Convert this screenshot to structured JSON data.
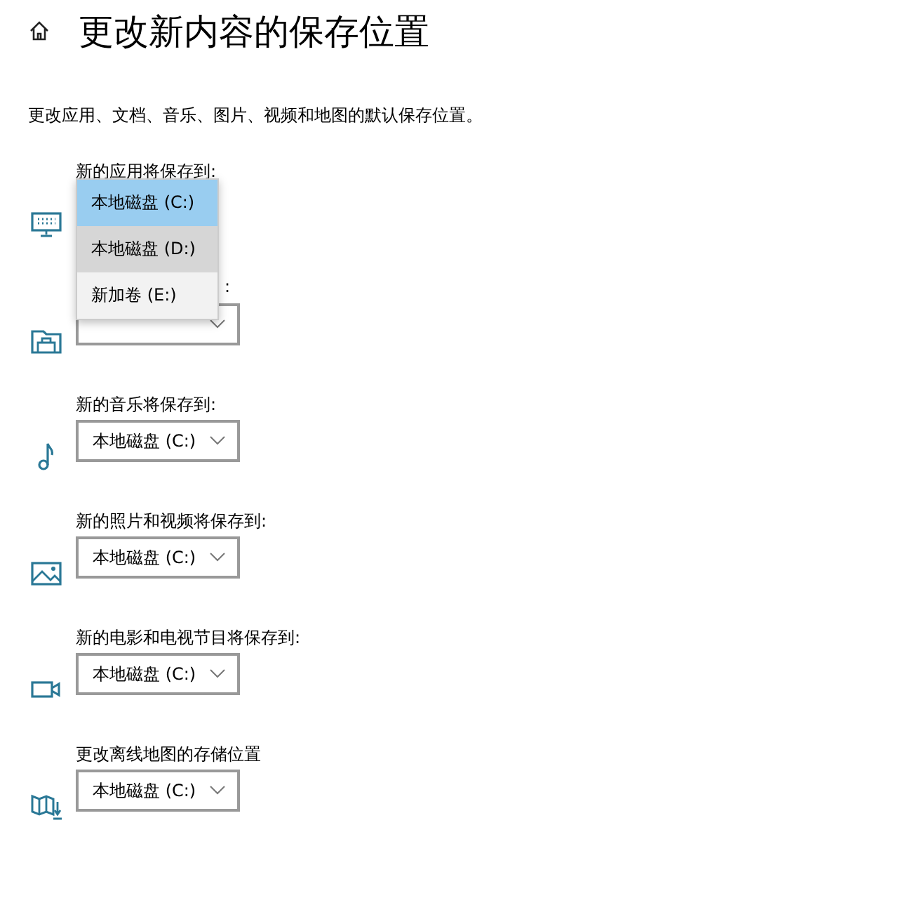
{
  "header": {
    "title": "更改新内容的保存位置"
  },
  "description": "更改应用、文档、音乐、图片、视频和地图的默认保存位置。",
  "sections": [
    {
      "kind": "apps",
      "label": "新的应用将保存到:",
      "expanded": true,
      "menu": [
        {
          "label": "本地磁盘 (C:)",
          "selected": true,
          "hovered": false
        },
        {
          "label": "本地磁盘 (D:)",
          "selected": false,
          "hovered": true
        },
        {
          "label": "新加卷 (E:)",
          "selected": false,
          "hovered": false
        }
      ]
    },
    {
      "kind": "documents",
      "label": ":",
      "expanded": false
    },
    {
      "kind": "music",
      "label": "新的音乐将保存到:",
      "value": "本地磁盘 (C:)",
      "expanded": false
    },
    {
      "kind": "photos",
      "label": "新的照片和视频将保存到:",
      "value": "本地磁盘 (C:)",
      "expanded": false
    },
    {
      "kind": "movies",
      "label": "新的电影和电视节目将保存到:",
      "value": "本地磁盘 (C:)",
      "expanded": false
    },
    {
      "kind": "maps",
      "label": "更改离线地图的存储位置",
      "value": "本地磁盘 (C:)",
      "expanded": false
    }
  ]
}
